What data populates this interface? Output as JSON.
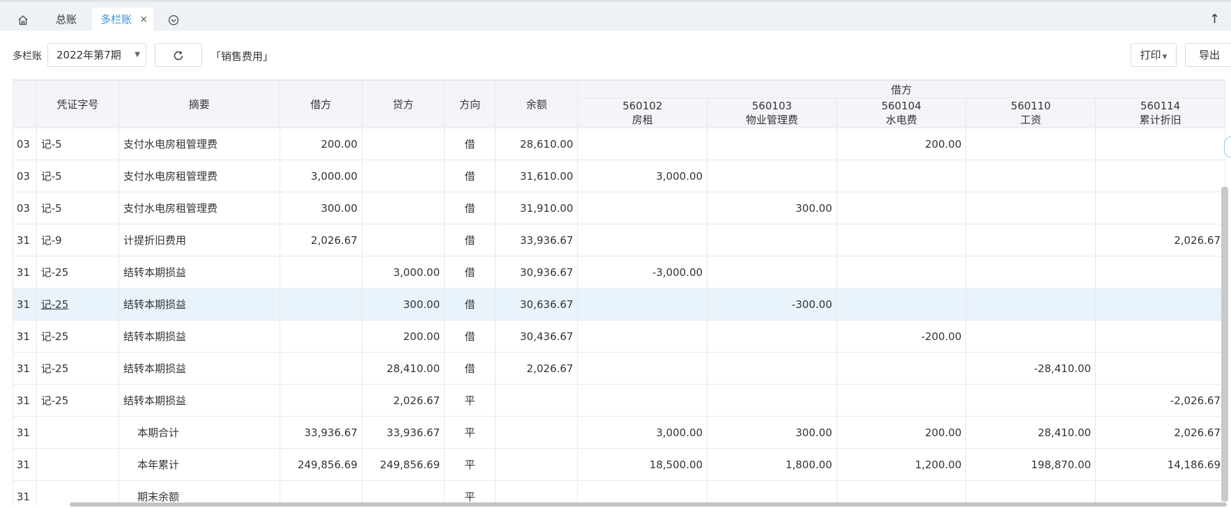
{
  "tabs": {
    "home_icon": "home-icon",
    "items": [
      {
        "label": "总账"
      },
      {
        "label": "多栏账",
        "active": true
      }
    ],
    "close_glyph": "×",
    "more_icon": "chevron-down-circle-icon",
    "up_glyph": "↑"
  },
  "toolbar": {
    "ledger_label": "多栏账",
    "period_value": "2022年第7期",
    "subject": "「销售费用」",
    "print_label": "打印",
    "export_label": "导出"
  },
  "table": {
    "headers": {
      "voucher": "凭证字号",
      "summary": "摘要",
      "debit": "借方",
      "credit": "贷方",
      "direction": "方向",
      "balance": "余额",
      "group": "借方"
    },
    "sub_columns": [
      {
        "code": "560102",
        "name": "房租"
      },
      {
        "code": "560103",
        "name": "物业管理费"
      },
      {
        "code": "560104",
        "name": "水电费"
      },
      {
        "code": "560110",
        "name": "工资"
      },
      {
        "code": "560114",
        "name": "累计折旧"
      }
    ],
    "rows": [
      {
        "date": "03",
        "voucher": "记-5",
        "summary": "支付水电房租管理费",
        "debit": "200.00",
        "credit": "",
        "dir": "借",
        "balance": "28,610.00",
        "c1": "",
        "c2": "",
        "c3": "200.00",
        "c4": "",
        "c5": ""
      },
      {
        "date": "03",
        "voucher": "记-5",
        "summary": "支付水电房租管理费",
        "debit": "3,000.00",
        "credit": "",
        "dir": "借",
        "balance": "31,610.00",
        "c1": "3,000.00",
        "c2": "",
        "c3": "",
        "c4": "",
        "c5": ""
      },
      {
        "date": "03",
        "voucher": "记-5",
        "summary": "支付水电房租管理费",
        "debit": "300.00",
        "credit": "",
        "dir": "借",
        "balance": "31,910.00",
        "c1": "",
        "c2": "300.00",
        "c3": "",
        "c4": "",
        "c5": ""
      },
      {
        "date": "31",
        "voucher": "记-9",
        "summary": "计提折旧费用",
        "debit": "2,026.67",
        "credit": "",
        "dir": "借",
        "balance": "33,936.67",
        "c1": "",
        "c2": "",
        "c3": "",
        "c4": "",
        "c5": "2,026.67"
      },
      {
        "date": "31",
        "voucher": "记-25",
        "summary": "结转本期损益",
        "debit": "",
        "credit": "3,000.00",
        "dir": "借",
        "balance": "30,936.67",
        "c1": "-3,000.00",
        "c2": "",
        "c3": "",
        "c4": "",
        "c5": ""
      },
      {
        "date": "31",
        "voucher": "记-25",
        "summary": "结转本期损益",
        "debit": "",
        "credit": "300.00",
        "dir": "借",
        "balance": "30,636.67",
        "c1": "",
        "c2": "-300.00",
        "c3": "",
        "c4": "",
        "c5": ""
      },
      {
        "date": "31",
        "voucher": "记-25",
        "summary": "结转本期损益",
        "debit": "",
        "credit": "200.00",
        "dir": "借",
        "balance": "30,436.67",
        "c1": "",
        "c2": "",
        "c3": "-200.00",
        "c4": "",
        "c5": ""
      },
      {
        "date": "31",
        "voucher": "记-25",
        "summary": "结转本期损益",
        "debit": "",
        "credit": "28,410.00",
        "dir": "借",
        "balance": "2,026.67",
        "c1": "",
        "c2": "",
        "c3": "",
        "c4": "-28,410.00",
        "c5": ""
      },
      {
        "date": "31",
        "voucher": "记-25",
        "summary": "结转本期损益",
        "debit": "",
        "credit": "2,026.67",
        "dir": "平",
        "balance": "",
        "c1": "",
        "c2": "",
        "c3": "",
        "c4": "",
        "c5": "-2,026.67"
      },
      {
        "date": "31",
        "voucher": "",
        "summary": "本期合计",
        "debit": "33,936.67",
        "credit": "33,936.67",
        "dir": "平",
        "balance": "",
        "c1": "3,000.00",
        "c2": "300.00",
        "c3": "200.00",
        "c4": "28,410.00",
        "c5": "2,026.67"
      },
      {
        "date": "31",
        "voucher": "",
        "summary": "本年累计",
        "debit": "249,856.69",
        "credit": "249,856.69",
        "dir": "平",
        "balance": "",
        "c1": "18,500.00",
        "c2": "1,800.00",
        "c3": "1,200.00",
        "c4": "198,870.00",
        "c5": "14,186.69"
      },
      {
        "date": "31",
        "voucher": "",
        "summary": "期末余额",
        "debit": "",
        "credit": "",
        "dir": "平",
        "balance": "",
        "c1": "",
        "c2": "",
        "c3": "",
        "c4": "",
        "c5": ""
      }
    ]
  }
}
